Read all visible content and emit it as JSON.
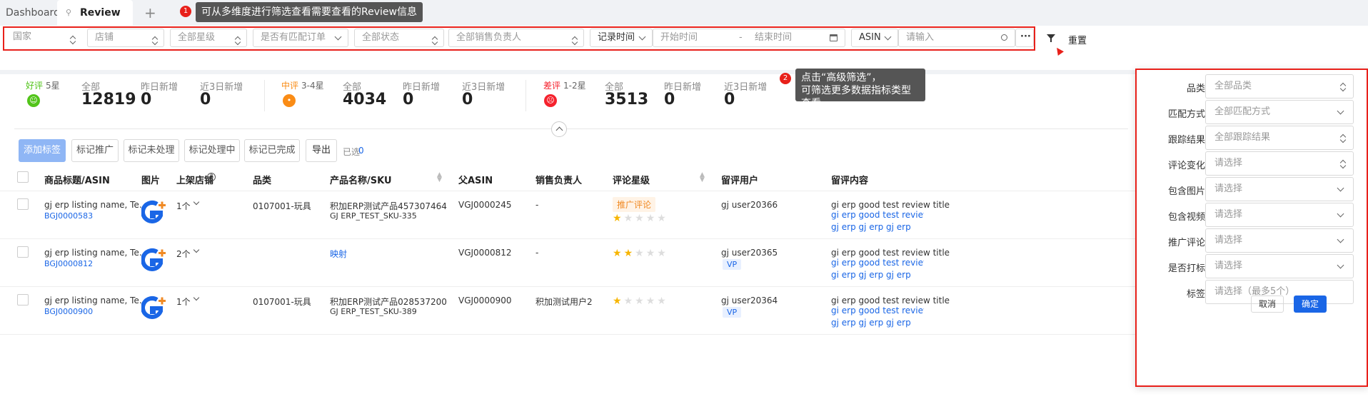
{
  "tabs": {
    "dashboard": "Dashboard",
    "review": "Review",
    "add": "+"
  },
  "tip1": {
    "num": "1",
    "text": "可从多维度进行筛选查看需要查看的Review信息"
  },
  "tip2": {
    "num": "2",
    "line1": "点击“高级筛选”，",
    "line2": "可筛选更多数据指标类型查看"
  },
  "filters": {
    "country": "国家",
    "shop": "店铺",
    "stars": "全部星级",
    "matched": "是否有匹配订单",
    "status": "全部状态",
    "owner": "全部销售负责人",
    "time_type": "记录时间",
    "start": "开始时间",
    "sep": "-",
    "end": "结束时间",
    "field": "ASIN",
    "input_placeholder": "请输入",
    "more": "···",
    "reset": "重置"
  },
  "stats": [
    {
      "type": "好评",
      "range": "5星",
      "color": "#52c41a",
      "all_label": "全部",
      "all": "12819",
      "y_label": "昨日新增",
      "y": "0",
      "d3_label": "近3日新增",
      "d3": "0"
    },
    {
      "type": "中评",
      "range": "3-4星",
      "color": "#fa8c16",
      "all_label": "全部",
      "all": "4034",
      "y_label": "昨日新增",
      "y": "0",
      "d3_label": "近3日新增",
      "d3": "0"
    },
    {
      "type": "差评",
      "range": "1-2星",
      "color": "#f5222d",
      "all_label": "全部",
      "all": "3513",
      "y_label": "昨日新增",
      "y": "0",
      "d3_label": "近3日新增",
      "d3": "0"
    }
  ],
  "actions": {
    "add_tag": "添加标签",
    "mark_promo": "标记推广",
    "mark_unhandled": "标记未处理",
    "mark_handling": "标记处理中",
    "mark_done": "标记已完成",
    "export": "导出",
    "selected": "已选",
    "selected_count": "0"
  },
  "columns": [
    "商品标题/ASIN",
    "图片",
    "上架店铺",
    "品类",
    "产品名称/SKU",
    "父ASIN",
    "销售负责人",
    "评论星级",
    "留评用户",
    "留评内容"
  ],
  "rows": [
    {
      "title": "gj erp listing name, Te...",
      "asin": "BGJ0000583",
      "shops": "1个",
      "category": "0107001-玩具",
      "product": "积加ERP测试产品457307464",
      "sku": "GJ ERP_TEST_SKU-335",
      "parent": "VGJ0000245",
      "owner": "-",
      "tag": "推广评论",
      "rating": 1,
      "user": "gj user20366",
      "vp": "",
      "content": "gi erp good test review title",
      "content2": "gi erp good test review con",
      "content3": "gj erp gj erp gj erp"
    },
    {
      "title": "gj erp listing name, Te...",
      "asin": "BGJ0000812",
      "shops": "2个",
      "category": "",
      "product": "映射",
      "sku": "",
      "parent": "VGJ0000812",
      "owner": "-",
      "tag": "",
      "rating": 2,
      "user": "gj user20365",
      "vp": "VP",
      "content": "gi erp good test review title",
      "content2": "gi erp good test review con",
      "content3": "gi erp gj erp gj erp"
    },
    {
      "title": "gj erp listing name, Te...",
      "asin": "BGJ0000900",
      "shops": "1个",
      "category": "0107001-玩具",
      "product": "积加ERP测试产品028537200",
      "sku": "GJ ERP_TEST_SKU-389",
      "parent": "VGJ0000900",
      "owner": "积加测试用户2",
      "tag": "",
      "rating": 1,
      "user": "gj user20364",
      "vp": "VP",
      "content": "gi erp good test review title",
      "content2": "gi erp good test review con",
      "content3": "gj erp gj erp gj erp"
    }
  ],
  "panel": {
    "fields": [
      {
        "label": "品类",
        "value": "全部品类",
        "arrow": "updown"
      },
      {
        "label": "匹配方式",
        "value": "全部匹配方式",
        "arrow": "down"
      },
      {
        "label": "跟踪结果",
        "value": "全部跟踪结果",
        "arrow": "updown"
      },
      {
        "label": "评论变化",
        "value": "请选择",
        "arrow": "updown"
      },
      {
        "label": "包含图片",
        "value": "请选择",
        "arrow": "down"
      },
      {
        "label": "包含视频",
        "value": "请选择",
        "arrow": "down"
      },
      {
        "label": "推广评论",
        "value": "请选择",
        "arrow": "down"
      },
      {
        "label": "是否打标",
        "value": "请选择",
        "arrow": "down"
      },
      {
        "label": "标签",
        "value": "请选择（最多5个）",
        "arrow": ""
      }
    ],
    "cancel": "取消",
    "confirm": "确定"
  },
  "colors": {
    "accent": "#1a66e6",
    "highlight": "#e8201a"
  }
}
